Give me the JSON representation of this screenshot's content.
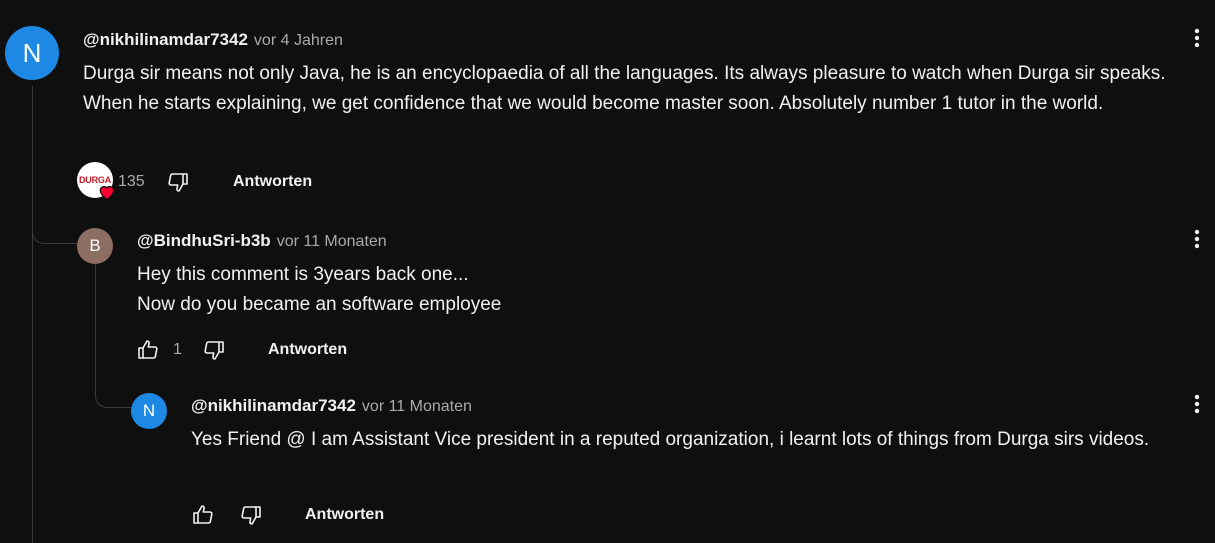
{
  "comments": [
    {
      "avatar_letter": "N",
      "avatar_color": "#1e88e5",
      "author": "@nikhilinamdar7342",
      "time": "vor 4 Jahren",
      "text": "Durga sir means not only Java, he is an encyclopaedia of all the languages. Its always pleasure to watch when Durga sir speaks. When he starts explaining, we get confidence that we would become master soon. Absolutely number 1 tutor in the world.",
      "likes": "135",
      "reply_label": "Antworten",
      "creator_heart_label": "DURGA"
    },
    {
      "avatar_letter": "B",
      "avatar_color": "#8d6e63",
      "author": "@BindhuSri-b3b",
      "time": "vor 11 Monaten",
      "text_lines": [
        "Hey this comment is 3years back one...",
        "Now do you became an software employee"
      ],
      "likes": "1",
      "reply_label": "Antworten"
    },
    {
      "avatar_letter": "N",
      "avatar_color": "#1e88e5",
      "author": "@nikhilinamdar7342",
      "time": "vor 11 Monaten",
      "text": "Yes Friend @ I am Assistant Vice president in a reputed organization, i learnt lots of things from Durga sirs videos.",
      "reply_label": "Antworten"
    }
  ],
  "icons": {
    "like": "thumbs-up-icon",
    "dislike": "thumbs-down-icon",
    "menu": "more-vert-icon",
    "heart": "heart-icon"
  },
  "colors": {
    "background": "#0f0f0f",
    "primary_text": "#f1f1f1",
    "secondary_text": "#aaaaaa",
    "heart": "#ff0033"
  }
}
